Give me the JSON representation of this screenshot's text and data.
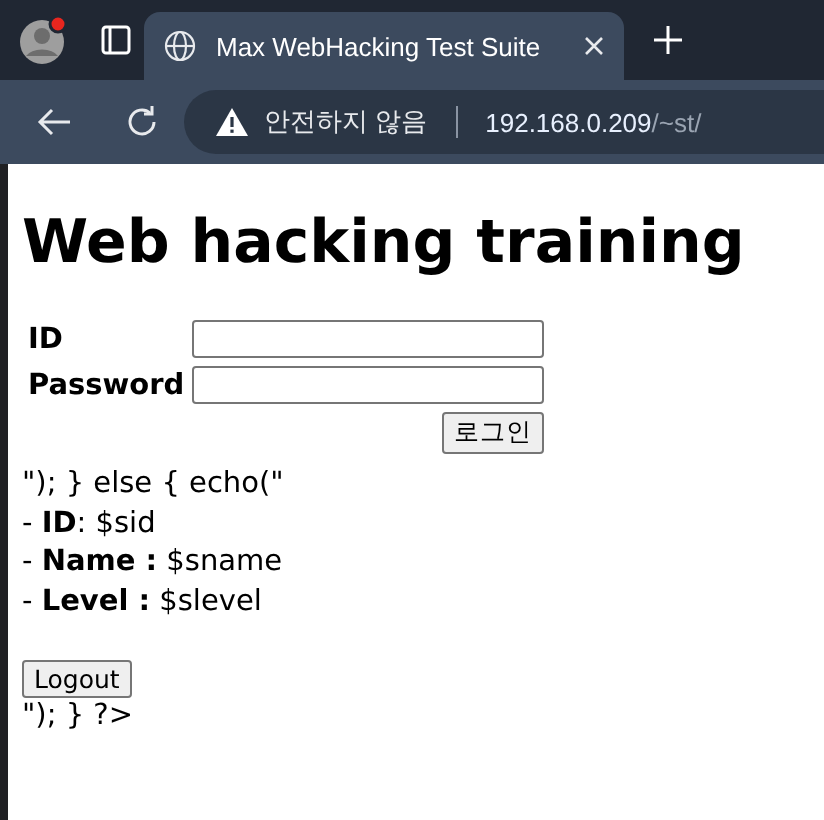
{
  "browser": {
    "tab": {
      "title": "Max WebHacking Test Suite",
      "selected": true
    },
    "address_bar": {
      "security_label": "안전하지 않음",
      "host": "192.168.0.209",
      "path": "/~st/"
    }
  },
  "page": {
    "heading": "Web hacking training",
    "form": {
      "fields": [
        {
          "label": "ID"
        },
        {
          "label": "Password"
        }
      ],
      "submit": "로그인"
    },
    "lines": [
      "\"); } else { echo(\"",
      "- **ID**: $sid",
      "- **Name :** $sname",
      "- **Level :** $slevel"
    ],
    "logout": "Logout",
    "tail": "\"); } ?>"
  }
}
